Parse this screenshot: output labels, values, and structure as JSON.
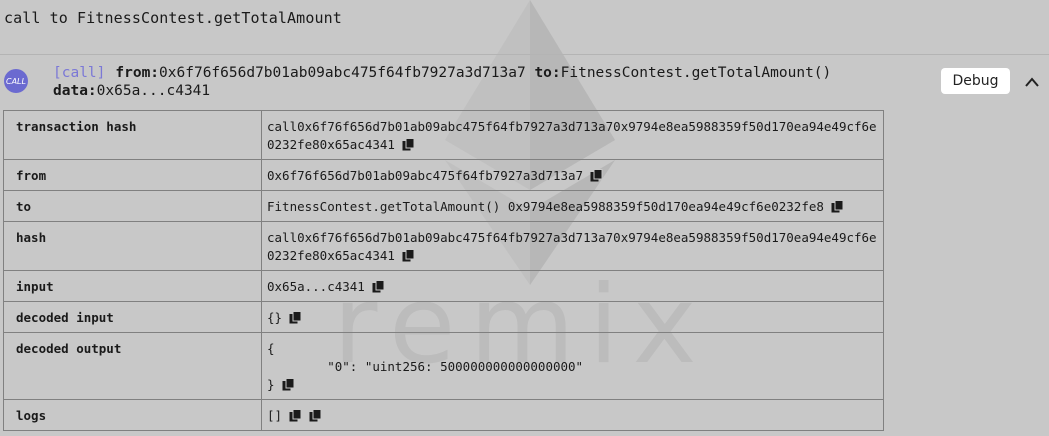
{
  "header": {
    "title": "call to FitnessContest.getTotalAmount"
  },
  "call": {
    "badge": "CALL",
    "tag": "[call]",
    "from_label": "from:",
    "from_value": "0x6f76f656d7b01ab09abc475f64fb7927a3d713a7",
    "to_label": "to:",
    "to_value": "FitnessContest.getTotalAmount()",
    "data_label": "data:",
    "data_value": "0x65a...c4341",
    "debug_label": "Debug"
  },
  "watermark": {
    "text": "remix"
  },
  "rows": [
    {
      "key": "transaction hash",
      "value": "call0x6f76f656d7b01ab09abc475f64fb7927a3d713a70x9794e8ea5988359f50d170ea94e49cf6e0232fe80x65ac4341"
    },
    {
      "key": "from",
      "value": "0x6f76f656d7b01ab09abc475f64fb7927a3d713a7"
    },
    {
      "key": "to",
      "value": "FitnessContest.getTotalAmount() 0x9794e8ea5988359f50d170ea94e49cf6e0232fe8"
    },
    {
      "key": "hash",
      "value": "call0x6f76f656d7b01ab09abc475f64fb7927a3d713a70x9794e8ea5988359f50d170ea94e49cf6e0232fe80x65ac4341"
    },
    {
      "key": "input",
      "value": "0x65a...c4341"
    },
    {
      "key": "decoded input",
      "value": "{}"
    },
    {
      "key": "decoded output",
      "lines": [
        "{",
        "        \"0\": \"uint256: 500000000000000000\"",
        "}"
      ]
    },
    {
      "key": "logs",
      "value": "[]"
    }
  ],
  "colors": {
    "background": "#c8c8c8",
    "accent": "#6b6ad0",
    "call_tag": "#7b78d6"
  },
  "icons": [
    "call-badge-icon",
    "copy-icon",
    "chevron-up-icon",
    "ethereum-logo"
  ]
}
